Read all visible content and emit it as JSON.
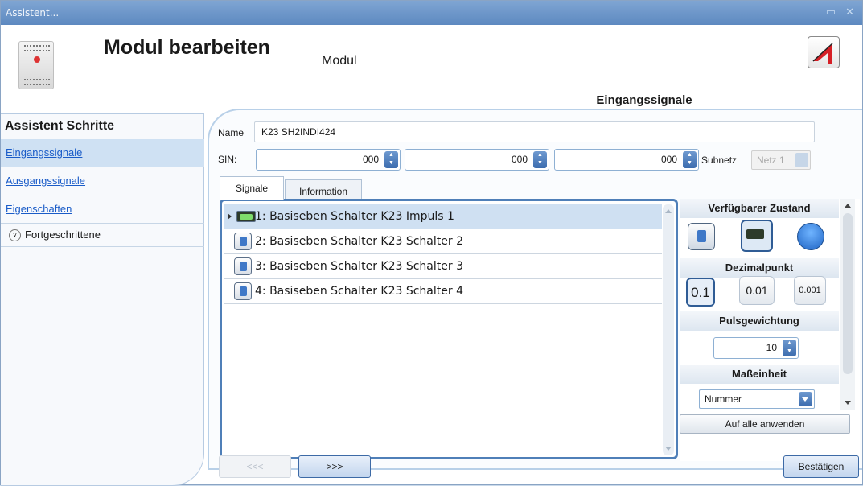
{
  "window": {
    "title": "Assistent...",
    "controls": "▭ ✕"
  },
  "header": {
    "title": "Modul bearbeiten",
    "subtitle": "Modul",
    "section_tab": "Eingangssignale"
  },
  "steps": {
    "title": "Assistent Schritte",
    "items": [
      {
        "label": "Eingangssignale",
        "active": true
      },
      {
        "label": "Ausgangssignale",
        "active": false
      },
      {
        "label": "Eigenschaften",
        "active": false
      }
    ],
    "advanced": {
      "label": "Fortgeschrittene",
      "icon": "chevron-down-icon"
    }
  },
  "form": {
    "name_label": "Name",
    "name_value": "K23 SH2INDI424",
    "sin_label": "SIN:",
    "sin_values": [
      "000",
      "000",
      "000"
    ],
    "subnet_label": "Subnetz",
    "subnet_value": "Netz 1"
  },
  "tabs": [
    {
      "label": "Signale",
      "active": true
    },
    {
      "label": "Information",
      "active": false
    }
  ],
  "signals": [
    {
      "label": "1: Basiseben Schalter K23 Impuls 1",
      "icon": "lcd-counter-icon",
      "selected": true
    },
    {
      "label": "2: Basiseben Schalter K23 Schalter 2",
      "icon": "switch-icon",
      "selected": false
    },
    {
      "label": "3: Basiseben Schalter K23 Schalter 3",
      "icon": "switch-icon",
      "selected": false
    },
    {
      "label": "4: Basiseben Schalter K23 Schalter 4",
      "icon": "switch-icon",
      "selected": false
    }
  ],
  "properties": {
    "state_header": "Verfügbarer Zustand",
    "state_options": [
      "switch-icon",
      "lcd-counter-icon",
      "push-button-icon"
    ],
    "state_selected": "lcd-counter-icon",
    "decimal_header": "Dezimalpunkt",
    "decimal_options": [
      "0.1",
      "0.01",
      "0.001"
    ],
    "decimal_selected": "0.1",
    "pulse_header": "Pulsgewichtung",
    "pulse_value": "10",
    "unit_header": "Maßeinheit",
    "unit_value": "Nummer",
    "apply_label": "Auf alle anwenden"
  },
  "footer": {
    "back_label": "<<<",
    "next_label": ">>>",
    "confirm_label": "Bestätigen"
  },
  "colors": {
    "accent": "#3c6cae",
    "selection": "#cfe0f2",
    "link": "#1a5cc8"
  }
}
